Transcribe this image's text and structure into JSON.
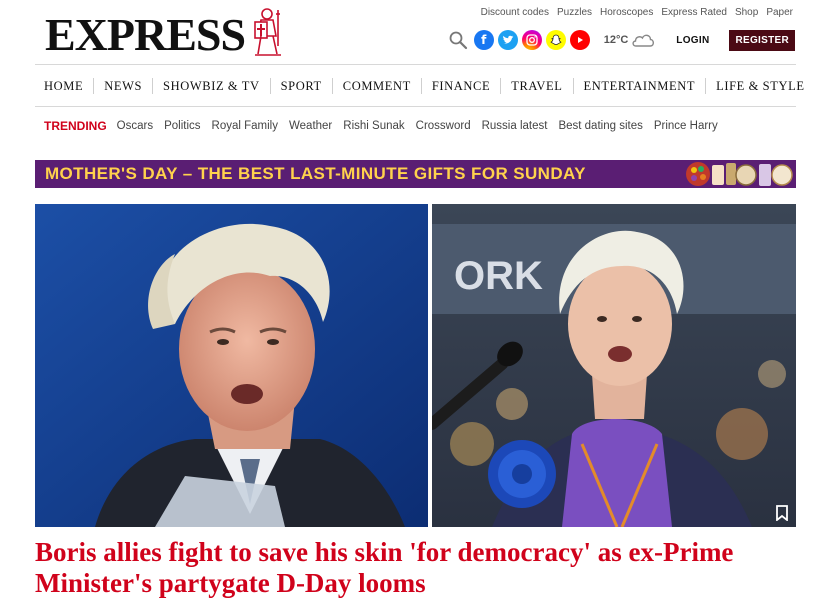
{
  "brand": {
    "logo_text": "EXPRESS",
    "accent_color": "#d0021b",
    "register_color": "#4b0a14"
  },
  "util_links": [
    "Discount codes",
    "Puzzles",
    "Horoscopes",
    "Express Rated",
    "Shop",
    "Paper"
  ],
  "header": {
    "icons": [
      "search-icon",
      "facebook-icon",
      "twitter-icon",
      "instagram-icon",
      "snapchat-icon",
      "youtube-icon",
      "cloud-icon"
    ],
    "temperature": "12°C",
    "login_label": "LOGIN",
    "register_label": "REGISTER"
  },
  "nav": [
    "HOME",
    "NEWS",
    "SHOWBIZ & TV",
    "SPORT",
    "COMMENT",
    "FINANCE",
    "TRAVEL",
    "ENTERTAINMENT",
    "LIFE & STYLE"
  ],
  "trending": {
    "label": "TRENDING",
    "items": [
      "Oscars",
      "Politics",
      "Royal Family",
      "Weather",
      "Rishi Sunak",
      "Crossword",
      "Russia latest",
      "Best dating sites",
      "Prince Harry"
    ]
  },
  "promo": {
    "text": "MOTHER'S DAY – THE BEST LAST-MINUTE GIFTS FOR SUNDAY",
    "bg_color": "#5a1e73",
    "text_color": "#ffd24c"
  },
  "photo_right": {
    "sign_text": "ORK"
  },
  "article": {
    "headline": "Boris allies fight to save his skin 'for democracy' as ex-Prime Minister's partygate D-Day looms",
    "bookmark_icon": "bookmark-icon"
  }
}
